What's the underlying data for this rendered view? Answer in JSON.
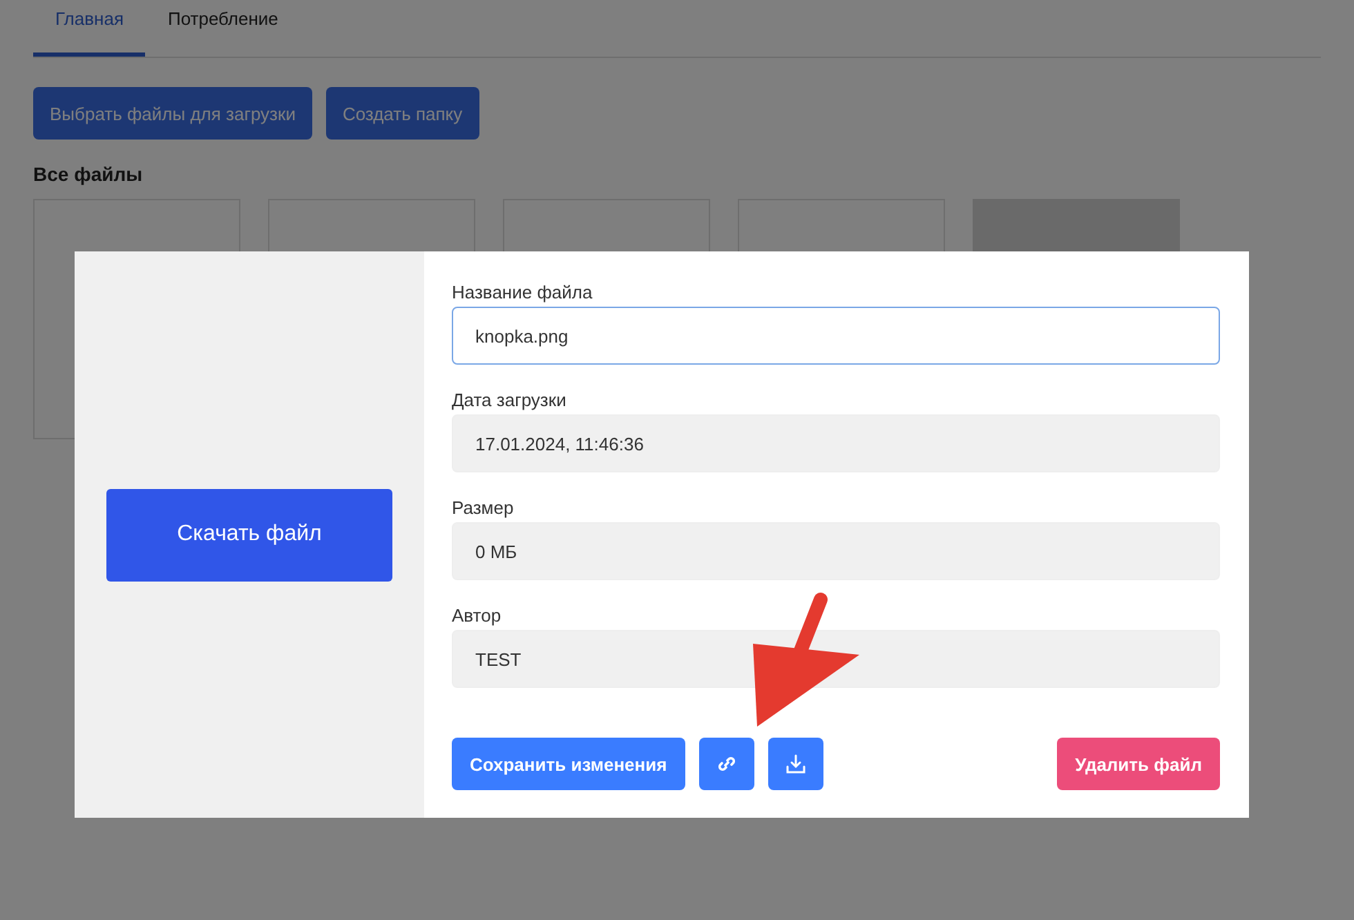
{
  "tabs": [
    {
      "label": "Главная",
      "selected": true
    },
    {
      "label": "Потребление",
      "selected": false
    }
  ],
  "toolbar": [
    "Выбрать файлы для загрузки",
    "Создать папку"
  ],
  "section_title": "Все файлы",
  "files": [
    {
      "kind": "blank"
    },
    {
      "kind": "blank"
    },
    {
      "kind": "blank"
    },
    {
      "kind": "blank"
    },
    {
      "kind": "image"
    }
  ],
  "dialog": {
    "download_button": "Скачать файл",
    "fields": [
      {
        "label": "Название файла",
        "value": "knopka.png",
        "kind": "input"
      },
      {
        "label": "Дата загрузки",
        "value": "17.01.2024, 11:46:36",
        "kind": "readonly"
      },
      {
        "label": "Размер",
        "value": "0 МБ",
        "kind": "readonly"
      },
      {
        "label": "Автор",
        "value": "TEST",
        "kind": "readonly"
      }
    ],
    "actions": [
      {
        "kind": "save",
        "label": "Сохранить изменения"
      },
      {
        "kind": "link"
      },
      {
        "kind": "download"
      },
      {
        "kind": "delete",
        "label": "Удалить файл"
      }
    ]
  }
}
